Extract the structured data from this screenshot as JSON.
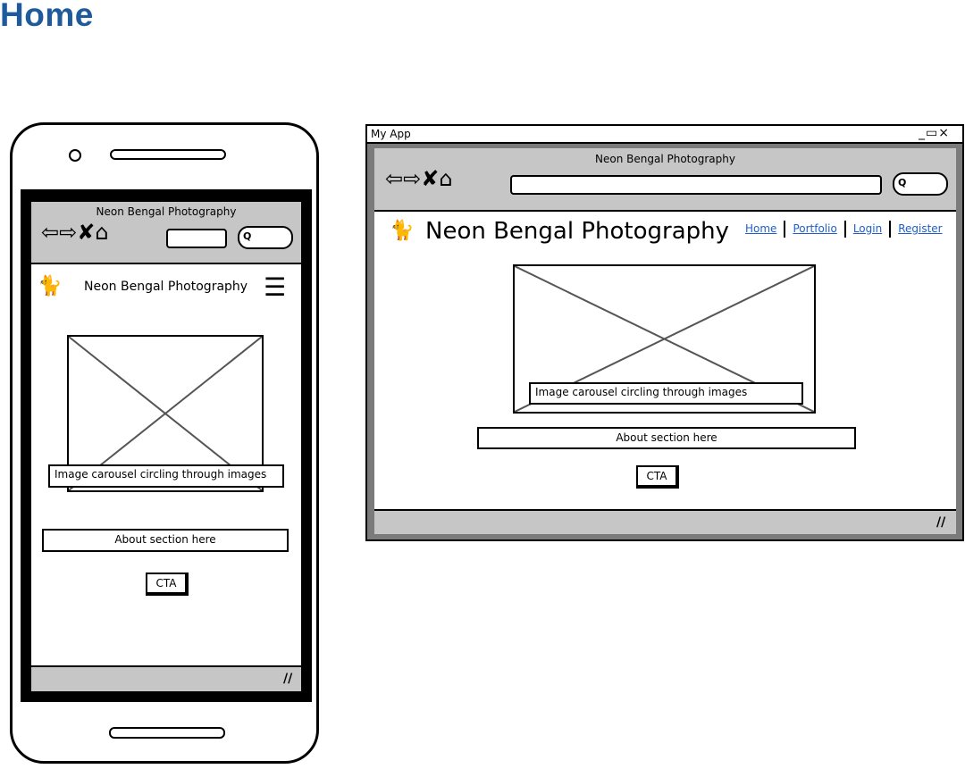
{
  "page": {
    "title": "Home"
  },
  "mobile": {
    "browser_title": "Neon Bengal Photography",
    "nav_icons": [
      "back-icon",
      "forward-icon",
      "close-icon",
      "home-icon"
    ],
    "brand": "Neon Bengal Photography",
    "logo_icon": "cat-icon",
    "menu_icon": "hamburger-icon",
    "carousel_caption": "Image carousel circling through images",
    "about": "About section here",
    "cta": "CTA"
  },
  "desktop": {
    "window_title": "My App",
    "window_controls": [
      "minimize-icon",
      "maximize-icon",
      "close-icon"
    ],
    "browser_title": "Neon Bengal Photography",
    "nav_icons": [
      "back-icon",
      "forward-icon",
      "close-icon",
      "home-icon"
    ],
    "brand": "Neon Bengal Photography",
    "logo_icon": "cat-icon",
    "nav_links": [
      "Home",
      "Portfolio",
      "Login",
      "Register"
    ],
    "carousel_caption": "Image carousel circling through images",
    "about": "About section here",
    "cta": "CTA"
  },
  "colors": {
    "title": "#1f5a9a",
    "link": "#1f5ec9",
    "chrome_grey": "#c6c6c6",
    "frame_grey": "#7b7b7b"
  }
}
